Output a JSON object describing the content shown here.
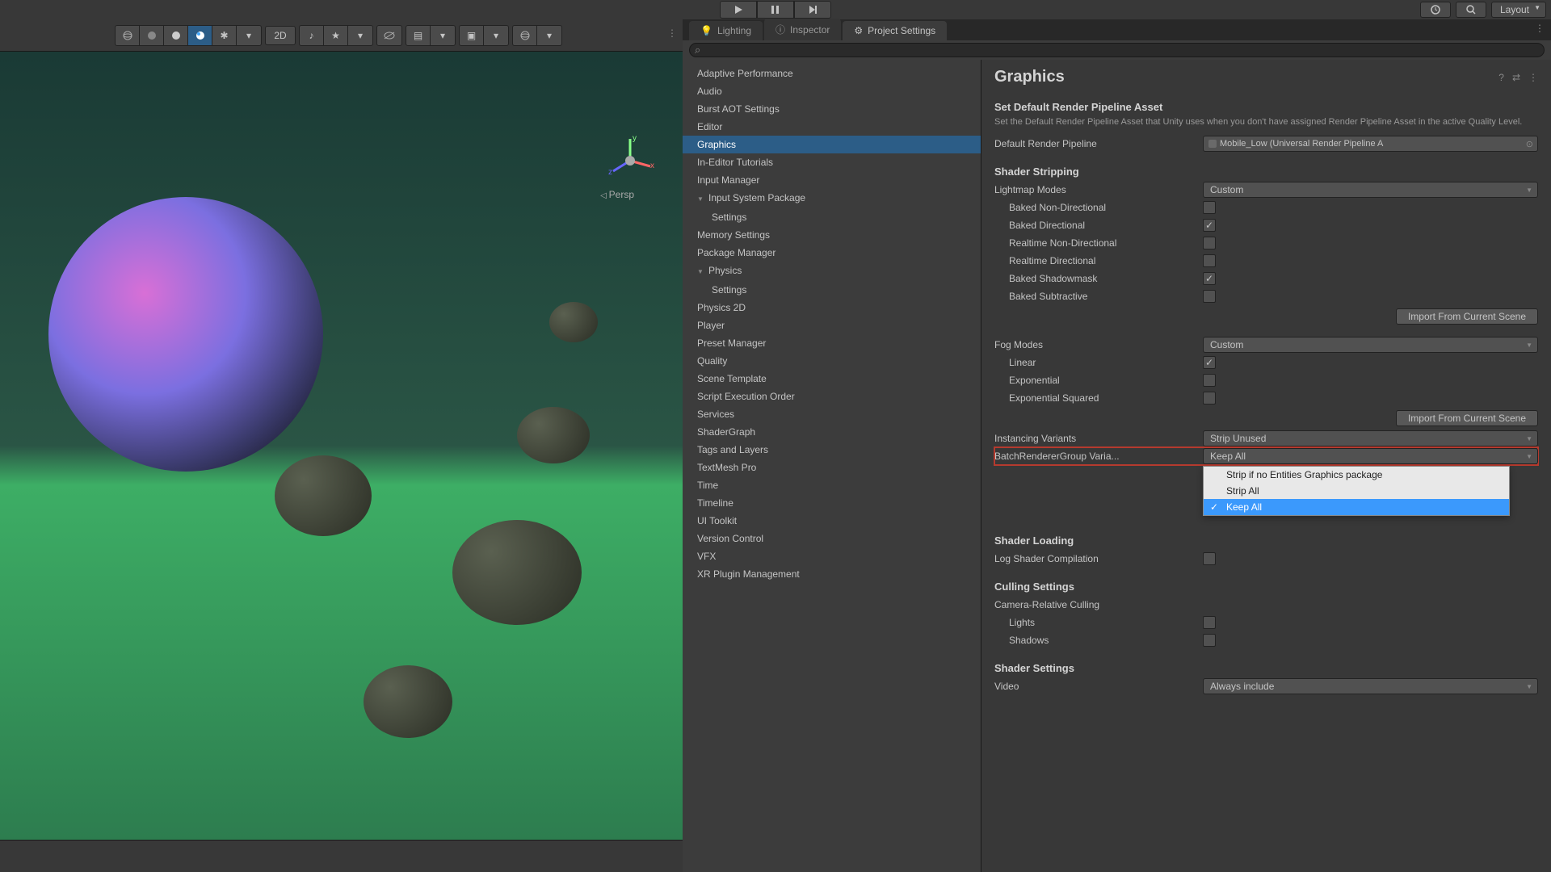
{
  "topbar": {
    "layout_label": "Layout"
  },
  "scene": {
    "persp_label": "Persp",
    "mode2d_label": "2D"
  },
  "tabs": {
    "lighting": "Lighting",
    "inspector": "Inspector",
    "project_settings": "Project Settings"
  },
  "categories": [
    "Adaptive Performance",
    "Audio",
    "Burst AOT Settings",
    "Editor",
    "Graphics",
    "In-Editor Tutorials",
    "Input Manager",
    "Input System Package",
    "Settings",
    "Memory Settings",
    "Package Manager",
    "Physics",
    "Settings",
    "Physics 2D",
    "Player",
    "Preset Manager",
    "Quality",
    "Scene Template",
    "Script Execution Order",
    "Services",
    "ShaderGraph",
    "Tags and Layers",
    "TextMesh Pro",
    "Time",
    "Timeline",
    "UI Toolkit",
    "Version Control",
    "VFX",
    "XR Plugin Management"
  ],
  "details": {
    "title": "Graphics",
    "setdefault_heading": "Set Default Render Pipeline Asset",
    "setdefault_desc": "Set the Default Render Pipeline Asset that Unity uses when you don't have assigned Render Pipeline Asset in the active Quality Level.",
    "default_pipeline_label": "Default Render Pipeline",
    "default_pipeline_value": "Mobile_Low (Universal Render Pipeline A",
    "shader_stripping": "Shader Stripping",
    "lightmap_modes_label": "Lightmap Modes",
    "lightmap_modes_value": "Custom",
    "baked_non_dir": "Baked Non-Directional",
    "baked_dir": "Baked Directional",
    "realtime_non_dir": "Realtime Non-Directional",
    "realtime_dir": "Realtime Directional",
    "baked_shadowmask": "Baked Shadowmask",
    "baked_subtractive": "Baked Subtractive",
    "import_scene_btn": "Import From Current Scene",
    "fog_modes_label": "Fog Modes",
    "fog_modes_value": "Custom",
    "linear": "Linear",
    "exponential": "Exponential",
    "exp_squared": "Exponential Squared",
    "instancing_label": "Instancing Variants",
    "instancing_value": "Strip Unused",
    "brg_label": "BatchRendererGroup Varia...",
    "brg_value": "Keep All",
    "brg_options": [
      "Strip if no Entities Graphics package",
      "Strip All",
      "Keep All"
    ],
    "shader_loading": "Shader Loading",
    "log_shader_comp": "Log Shader Compilation",
    "culling_settings": "Culling Settings",
    "camera_rel_culling": "Camera-Relative Culling",
    "lights": "Lights",
    "shadows": "Shadows",
    "shader_settings": "Shader Settings",
    "video_label": "Video",
    "video_value": "Always include"
  }
}
